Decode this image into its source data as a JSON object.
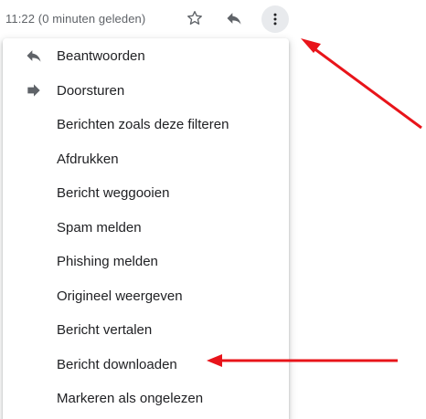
{
  "header": {
    "timestamp": "11:22 (0 minuten geleden)",
    "star_icon": "star-outline-icon",
    "reply_icon": "reply-icon",
    "more_icon": "more-vert-icon"
  },
  "menu": {
    "items": [
      {
        "label": "Beantwoorden",
        "icon": "reply-icon"
      },
      {
        "label": "Doorsturen",
        "icon": "forward-icon"
      },
      {
        "label": "Berichten zoals deze filteren"
      },
      {
        "label": "Afdrukken"
      },
      {
        "label": "Bericht weggooien"
      },
      {
        "label": "Spam melden"
      },
      {
        "label": "Phishing melden"
      },
      {
        "label": "Origineel weergeven"
      },
      {
        "label": "Bericht vertalen"
      },
      {
        "label": "Bericht downloaden"
      },
      {
        "label": "Markeren als ongelezen"
      }
    ]
  },
  "annotations": {
    "arrow_color": "#e8141a"
  },
  "colors": {
    "icon_gray": "#5f6368",
    "text": "#202124",
    "more_button_bg": "#e8eaed"
  }
}
